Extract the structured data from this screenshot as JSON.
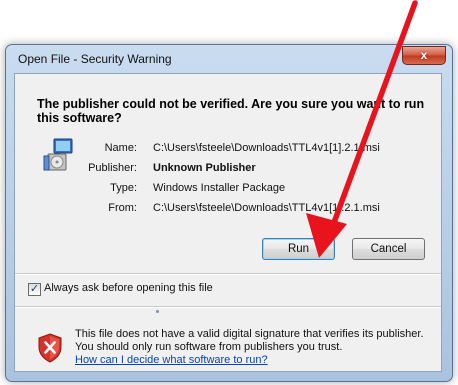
{
  "window": {
    "title": "Open File - Security Warning",
    "close_label": "x"
  },
  "heading": "The publisher could not be verified.  Are you sure you want to run this software?",
  "fields": [
    {
      "label": "Name:",
      "value": "C:\\Users\\fsteele\\Downloads\\TTL4v1[1].2.1.msi",
      "bold": false
    },
    {
      "label": "Publisher:",
      "value": "Unknown Publisher",
      "bold": true
    },
    {
      "label": "Type:",
      "value": "Windows Installer Package",
      "bold": false
    },
    {
      "label": "From:",
      "value": "C:\\Users\\fsteele\\Downloads\\TTL4v1[1].2.1.msi",
      "bold": false
    }
  ],
  "buttons": {
    "run": "Run",
    "cancel": "Cancel"
  },
  "checkbox": {
    "label": "Always ask before opening this file",
    "checked": true,
    "mark": "✓"
  },
  "warning": {
    "text": "This file does not have a valid digital signature that verifies its publisher.  You should only run software from publishers you trust.",
    "link": "How can I decide what software to run?"
  },
  "colors": {
    "annotation_arrow": "#e8131c",
    "shield_red": "#d8302a",
    "link": "#0645ad"
  }
}
